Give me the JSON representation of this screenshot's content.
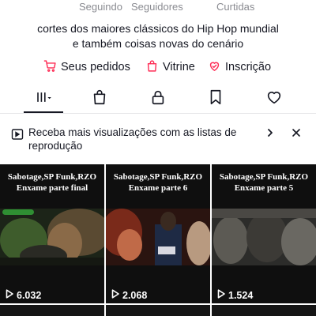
{
  "profile_stats": {
    "following_label": "Seguindo",
    "followers_label": "Seguidores",
    "likes_label": "Curtidas"
  },
  "bio": {
    "line1": "cortes dos maiores clássicos do Hip Hop mundial",
    "line2": "e também coisas novas do cenário"
  },
  "profile_links": [
    {
      "label": "Seus pedidos",
      "icon": "cart-icon"
    },
    {
      "label": "Vitrine",
      "icon": "shopping-bag-icon"
    },
    {
      "label": "Inscrição",
      "icon": "subscription-heart-icon"
    }
  ],
  "tabs": [
    {
      "id": "videos",
      "icon": "grid-videos-icon",
      "active": true
    },
    {
      "id": "shop",
      "icon": "shopping-bag-icon",
      "active": false
    },
    {
      "id": "private",
      "icon": "lock-icon",
      "active": false
    },
    {
      "id": "saved",
      "icon": "bookmark-icon",
      "active": false
    },
    {
      "id": "liked",
      "icon": "heart-icon",
      "active": false
    }
  ],
  "playlist_banner": {
    "text": "Receba mais visualizações com as listas de reprodução",
    "icon": "playlist-icon"
  },
  "videos": [
    {
      "title_line1": "Sabotage,SP Funk,RZO",
      "title_line2": "Enxame parte final",
      "views": "6.032"
    },
    {
      "title_line1": "Sabotage,SP Funk,RZO",
      "title_line2": "Enxame parte 6",
      "views": "2.068"
    },
    {
      "title_line1": "Sabotage,SP Funk,RZO",
      "title_line2": "Enxame parte 5",
      "views": "1.524"
    }
  ],
  "colors": {
    "accent": "#fe2c55",
    "text_primary": "#161823",
    "text_secondary": "#8a8b91"
  }
}
